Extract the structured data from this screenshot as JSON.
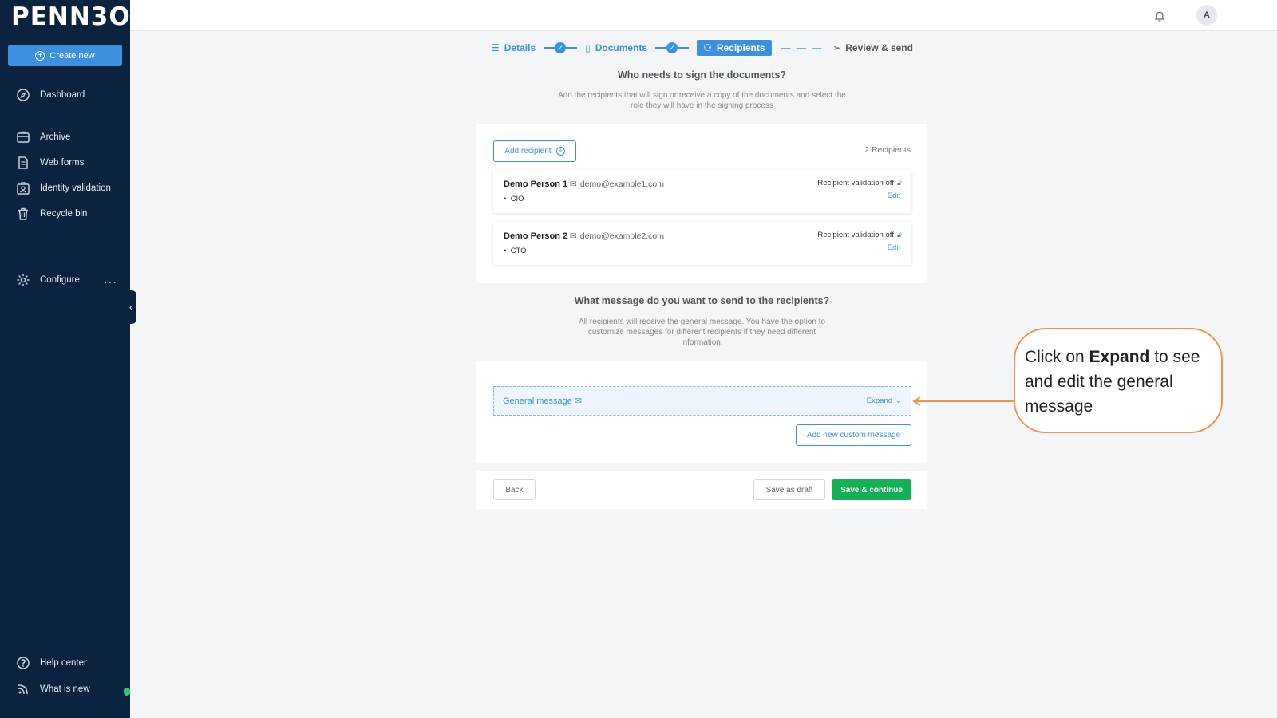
{
  "sidebar": {
    "logo": "PENN3O",
    "create_label": "Create new",
    "items": [
      {
        "label": "Dashboard",
        "icon": "compass-icon"
      },
      {
        "label": "Archive",
        "icon": "archive-icon"
      },
      {
        "label": "Web forms",
        "icon": "document-icon"
      },
      {
        "label": "Identity validation",
        "icon": "id-badge-icon"
      },
      {
        "label": "Recycle bin",
        "icon": "trash-icon"
      },
      {
        "label": "Configure",
        "icon": "gear-icon"
      },
      {
        "label": "Help center",
        "icon": "help-icon"
      },
      {
        "label": "What is new",
        "icon": "broadcast-icon"
      }
    ],
    "more_label": "···"
  },
  "topbar": {
    "avatar_initial": "A"
  },
  "stepper": {
    "steps": [
      {
        "label": "Details",
        "state": "done"
      },
      {
        "label": "Documents",
        "state": "done"
      },
      {
        "label": "Recipients",
        "state": "active"
      },
      {
        "label": "Review & send",
        "state": "pending"
      }
    ]
  },
  "recipients_section": {
    "title": "Who needs to sign the documents?",
    "subtitle": "Add the recipients that will sign or receive a copy of the documents and select the role they will have in the signing process",
    "add_label": "Add recipient",
    "count_label": "2 Recipients",
    "list": [
      {
        "name": "Demo Person 1",
        "email": "demo@example1.com",
        "role": "CIO",
        "validation": "Recipient validation off",
        "edit": "Edit"
      },
      {
        "name": "Demo Person 2",
        "email": "demo@example2.com",
        "role": "CTO",
        "validation": "Recipient validation off",
        "edit": "Edit"
      }
    ]
  },
  "message_section": {
    "title": "What message do you want to send to the recipients?",
    "subtitle": "All recipients will receive the general message. You have the option to customize messages for different recipients if they need different information.",
    "general_label": "General message",
    "expand_label": "Expand",
    "add_custom_label": "Add new custom message"
  },
  "footer": {
    "back_label": "Back",
    "draft_label": "Save as draft",
    "continue_label": "Save & continue"
  },
  "callout": {
    "pre": "Click on ",
    "bold": "Expand",
    "post": " to see and edit  the general message"
  },
  "colors": {
    "accent": "#3b91e0",
    "sidebar": "#0c2340",
    "success": "#13b156",
    "callout": "#f0944d"
  }
}
